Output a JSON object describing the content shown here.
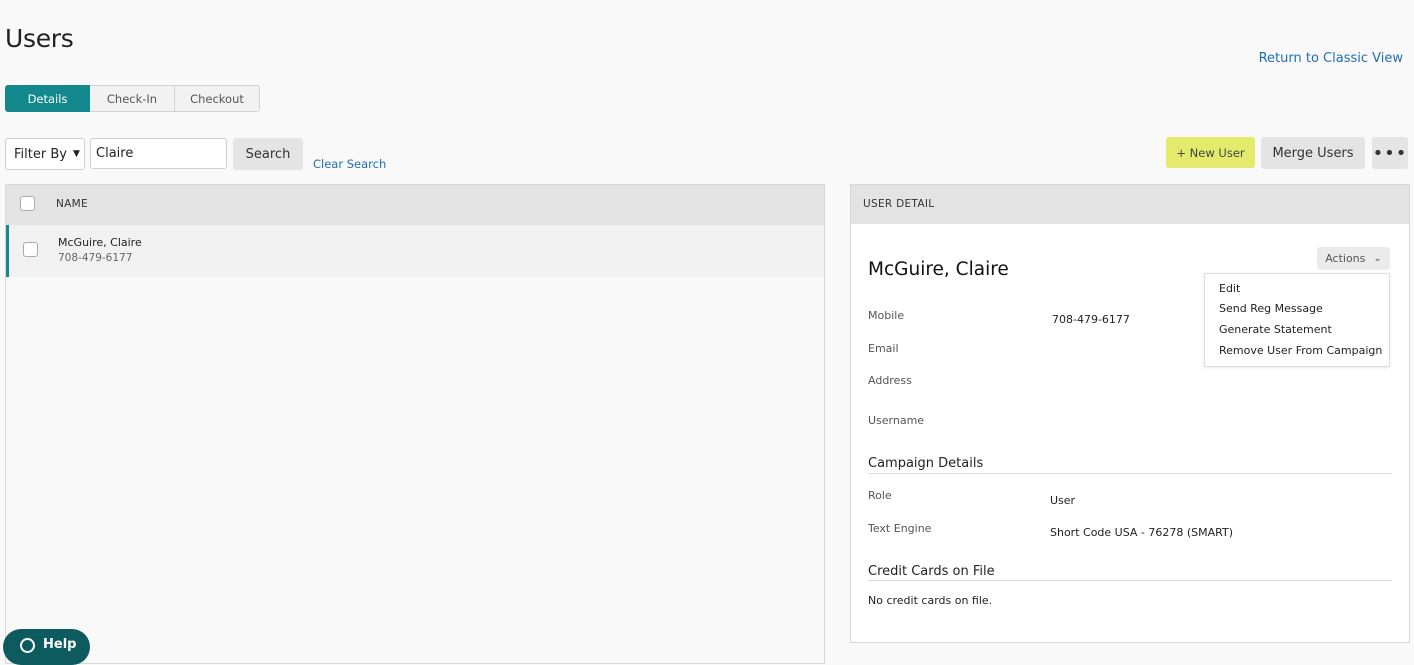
{
  "page": {
    "title": "Users",
    "classic_link": "Return to Classic View"
  },
  "tabs": [
    {
      "label": "Details",
      "active": true
    },
    {
      "label": "Check-In",
      "active": false
    },
    {
      "label": "Checkout",
      "active": false
    }
  ],
  "toolbar": {
    "filter_label": "Filter By",
    "search_value": "Claire",
    "search_label": "Search",
    "clear_label": "Clear Search",
    "new_user_label": "+ New User",
    "merge_label": "Merge Users",
    "more_label": "•••"
  },
  "list": {
    "column_name": "NAME",
    "rows": [
      {
        "name": "McGuire, Claire",
        "phone": "708-479-6177"
      }
    ]
  },
  "detail": {
    "header": "USER DETAIL",
    "name": "McGuire, Claire",
    "actions_label": "Actions",
    "actions_menu": [
      "Edit",
      "Send Reg Message",
      "Generate Statement",
      "Remove User From Campaign"
    ],
    "fields": {
      "mobile_label": "Mobile",
      "mobile_value": "708-479-6177",
      "email_label": "Email",
      "address_label": "Address",
      "username_label": "Username"
    },
    "campaign": {
      "title": "Campaign Details",
      "role_label": "Role",
      "role_value": "User",
      "engine_label": "Text Engine",
      "engine_value": "Short Code USA - 76278 (SMART)"
    },
    "cards": {
      "title": "Credit Cards on File",
      "empty": "No credit cards on file."
    }
  },
  "help": {
    "label": "Help"
  },
  "colors": {
    "accent": "#13898e",
    "new_user": "#e4ea6b",
    "help": "#0d5b5e",
    "link": "#1f6fb2"
  }
}
